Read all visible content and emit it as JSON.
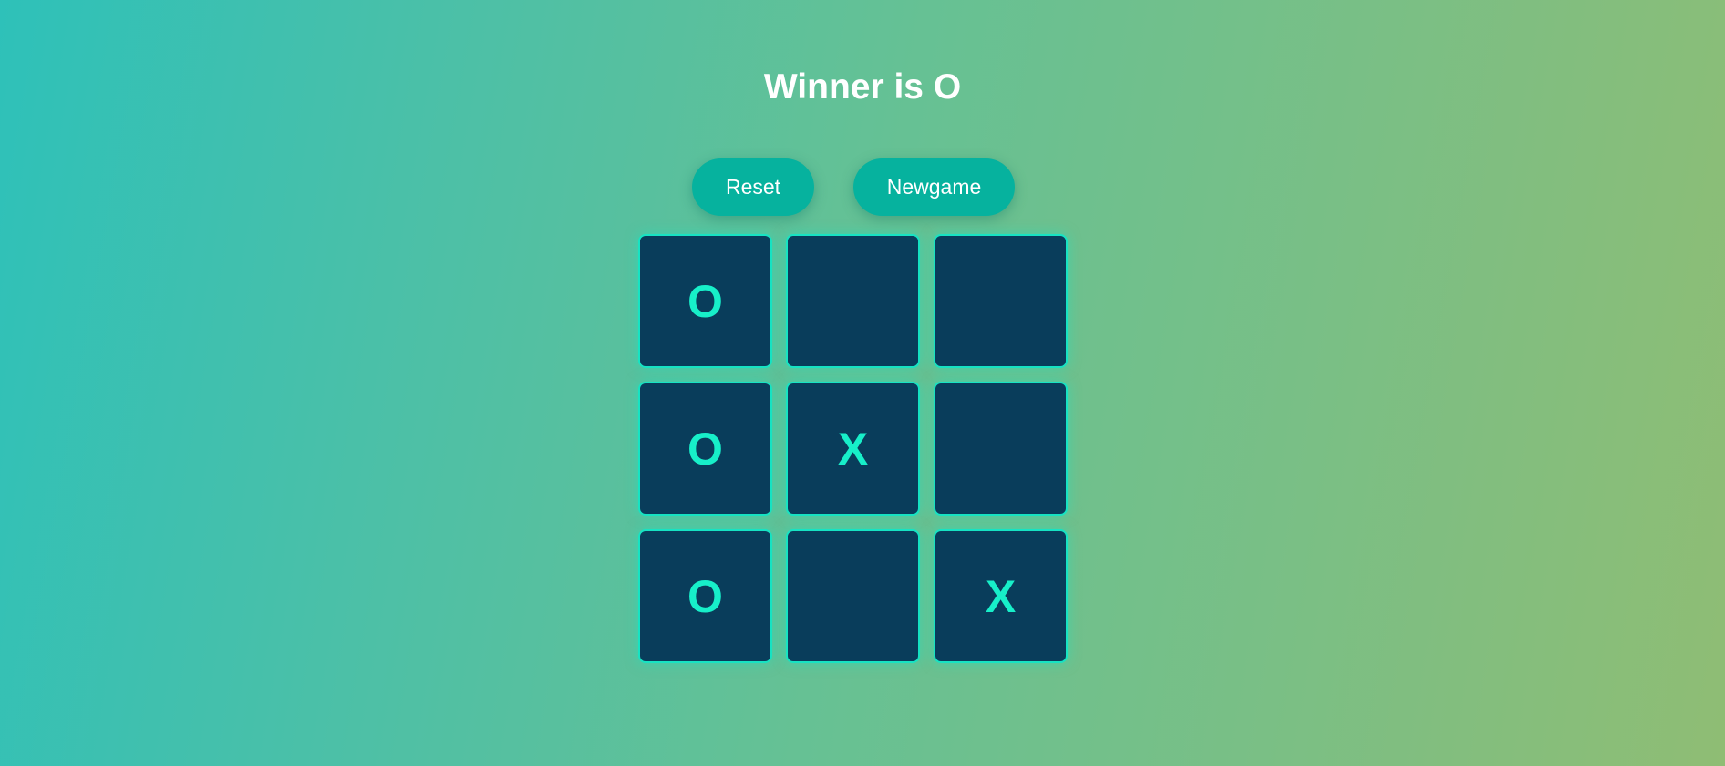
{
  "status": {
    "title": "Winner is O"
  },
  "controls": {
    "reset_label": "Reset",
    "newgame_label": "Newgame"
  },
  "board": {
    "cells": [
      "O",
      "",
      "",
      "O",
      "X",
      "",
      "O",
      "",
      "X"
    ]
  },
  "colors": {
    "cell_background": "#093d5b",
    "cell_border": "#17e3c3",
    "mark": "#17efc9",
    "button": "#06b29e"
  }
}
